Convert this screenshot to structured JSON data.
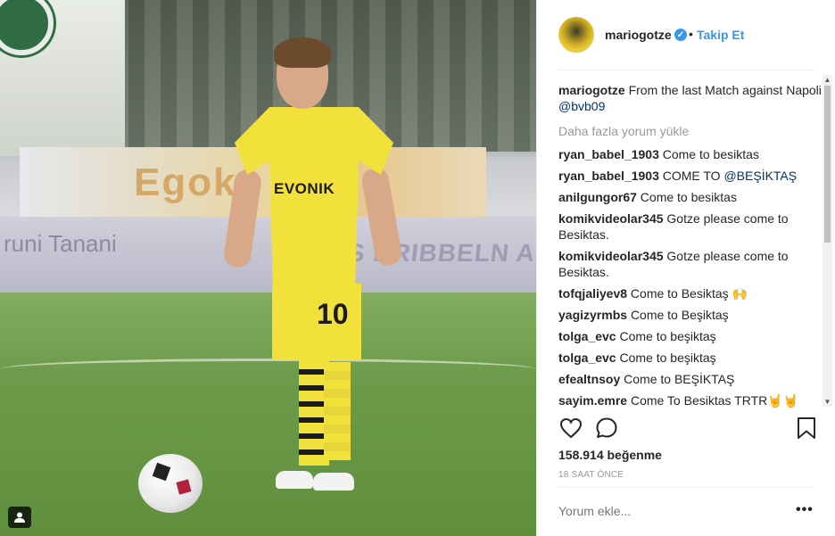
{
  "photo": {
    "sponsor_text": "EVONIK",
    "shorts_number": "10",
    "board_text": "Egok",
    "board_text2": "runi Tanani",
    "board_text3": "S DRIBBELN A",
    "tag_icon": "user-tag-icon"
  },
  "post": {
    "username": "mariogotze",
    "dot": "•",
    "follow_label": "Takip Et",
    "caption_text": "From the last Match against Napoli",
    "caption_mention": "@bvb09",
    "load_more": "Daha fazla yorum yükle",
    "comments": [
      {
        "user": "ryan_babel_1903",
        "text": "Come to besiktas"
      },
      {
        "user": "ryan_babel_1903",
        "text": "COME TO ",
        "mention": "@BEŞİKTAŞ"
      },
      {
        "user": "anilgungor67",
        "text": "Come to besiktas"
      },
      {
        "user": "komikvideolar345",
        "text": "Gotze please come to Besiktas."
      },
      {
        "user": "komikvideolar345",
        "text": "Gotze please come to Besiktas."
      },
      {
        "user": "tofqjaliyev8",
        "text": "Come to Besiktaş 🙌"
      },
      {
        "user": "yagizyrmbs",
        "text": "Come to Beşiktaş"
      },
      {
        "user": "tolga_evc",
        "text": "Come to beşiktaş"
      },
      {
        "user": "tolga_evc",
        "text": "Come to beşiktaş"
      },
      {
        "user": "efealtnsoy",
        "text": "Come to BEŞİKTAŞ"
      },
      {
        "user": "sayim.emre",
        "text": "Come To Besiktas TRTR🤘🤘"
      }
    ],
    "likes": "158.914 beğenme",
    "time_ago": "18 SAAT ÖNCE",
    "comment_placeholder": "Yorum ekle...",
    "more_label": "•••"
  },
  "colors": {
    "accent": "#3897f0",
    "mention": "#003569",
    "muted": "#999999",
    "text": "#262626"
  }
}
